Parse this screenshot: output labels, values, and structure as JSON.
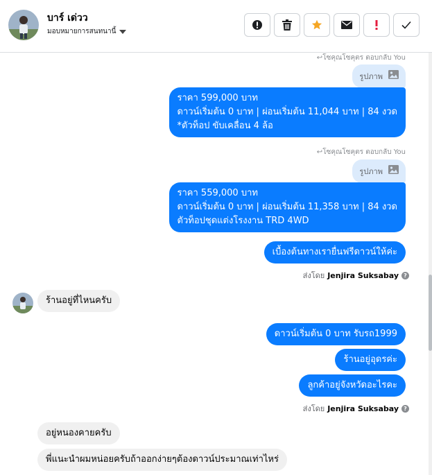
{
  "header": {
    "contact_name": "บาร์ เด่วว",
    "assign_label": "มอบหมายการสนทนานี้"
  },
  "toolbar": {
    "icons": [
      "alert-circle-icon",
      "trash-icon",
      "star-icon",
      "mail-icon",
      "exclamation-icon",
      "check-icon"
    ],
    "accent": "#f5a623",
    "danger": "#e41e3f"
  },
  "thread": {
    "reply1": {
      "meta": "โซคุณโซคุตร ตอบกลับ You",
      "quote_label": "รูปภาพ",
      "lines": [
        "ราคา 599,000 บาท",
        "ดาวน์เริ่มต้น 0 บาท | ผ่อนเริ่มต้น 11,044 บาท | 84 งวด",
        "*ตัวท็อป ขับเคลื่อน 4 ล้อ"
      ]
    },
    "reply2": {
      "meta": "โซคุณโซคุตร ตอบกลับ You",
      "quote_label": "รูปภาพ",
      "lines": [
        "ราคา 559,000 บาท",
        "ดาวน์เริ่มต้น 0 บาท | ผ่อนเริ่มต้น 11,358 บาท | 84 งวด",
        " ตัวท็อปชุดแต่งโรงงาน TRD 4WD"
      ]
    },
    "msg_free_down": "เบื้องต้นทางเรายื่นฟรีดาวน์ให้ค่ะ",
    "sent_by_label": "ส่งโดย",
    "sent_by_name": "Jenjira Suksabay",
    "incoming1": "ร้านอยู่ที่ไหนครับ",
    "msg_down_zero": "ดาวน์เริ่มต้น 0 บาท รับรถ1999",
    "msg_shop_location": "ร้านอยู่อุดรค่ะ",
    "msg_which_province": "ลูกค้าอยู่จังหวัดอะไรคะ",
    "incoming2": "อยู่หนองคายครับ",
    "incoming3": "พี่แนะนำผมหน่อยครับถ้าออกง่ายๆต้องดาวน์ประมาณเท่าไหร่"
  },
  "colors": {
    "outgoing_bubble": "#0a7cff",
    "incoming_bubble": "#f0f0f0",
    "quote_bubble": "#dcebfc"
  }
}
